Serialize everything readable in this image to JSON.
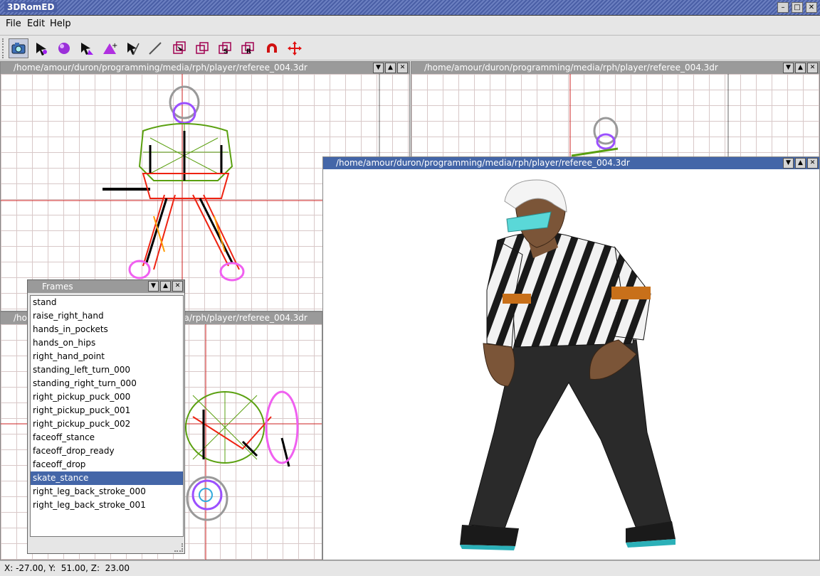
{
  "app": {
    "title": "3DRomED"
  },
  "window_buttons": [
    "–",
    "□",
    "✕"
  ],
  "menu": [
    {
      "label": "File"
    },
    {
      "label": "Edit"
    },
    {
      "label": "Help"
    }
  ],
  "toolbar": {
    "tools": [
      {
        "icon": "camera-icon"
      },
      {
        "icon": "select-vertex-icon"
      },
      {
        "icon": "sphere-icon"
      },
      {
        "icon": "select-triangle-icon"
      },
      {
        "icon": "add-triangle-icon"
      },
      {
        "icon": "pick-edge-icon"
      },
      {
        "icon": "line-icon"
      },
      {
        "icon": "box-select-icon"
      },
      {
        "icon": "cube-icon"
      },
      {
        "icon": "scale-box-icon",
        "letter": "S"
      },
      {
        "icon": "rotate-box-icon",
        "letter": "R"
      },
      {
        "icon": "magnet-icon"
      },
      {
        "icon": "move-arrows-icon"
      }
    ]
  },
  "viewports": {
    "top_left": {
      "title": "/home/amour/duron/programming/media/rph/player/referee_004.3dr"
    },
    "top_right": {
      "title": "/home/amour/duron/programming/media/rph/player/referee_004.3dr"
    },
    "bottom_left": {
      "title": "/home/amour/duron/programming/media/rph/player/referee_004.3dr"
    },
    "render": {
      "title": "/home/amour/duron/programming/media/rph/player/referee_004.3dr"
    }
  },
  "frames": {
    "title": "Frames",
    "items": [
      "stand",
      "raise_right_hand",
      "hands_in_pockets",
      "hands_on_hips",
      "right_hand_point",
      "standing_left_turn_000",
      "standing_right_turn_000",
      "right_pickup_puck_000",
      "right_pickup_puck_001",
      "right_pickup_puck_002",
      "faceoff_stance",
      "faceoff_drop_ready",
      "faceoff_drop",
      "skate_stance",
      "right_leg_back_stroke_000",
      "right_leg_back_stroke_001"
    ],
    "selected": "skate_stance"
  },
  "status": {
    "coords": "X: -27.00, Y:  51.00, Z:  23.00"
  },
  "colors": {
    "active_title": "#4466a8",
    "inactive_title": "#9a9a9a",
    "axis": "#cc2222"
  }
}
